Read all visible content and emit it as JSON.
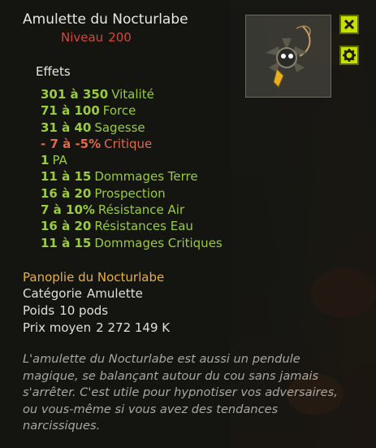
{
  "item": {
    "name": "Amulette du Nocturlabe",
    "level_label": "Niveau",
    "level_value": "200"
  },
  "effects_title": "Effets",
  "effects": [
    {
      "range": "301 à 350",
      "stat": "Vitalité",
      "negative": false
    },
    {
      "range": "71 à 100",
      "stat": "Force",
      "negative": false
    },
    {
      "range": "31 à 40",
      "stat": "Sagesse",
      "negative": false
    },
    {
      "range": "- 7 à -5%",
      "stat": "Critique",
      "negative": true
    },
    {
      "range": "1",
      "stat": "PA",
      "negative": false
    },
    {
      "range": "11 à 15",
      "stat": "Dommages Terre",
      "negative": false
    },
    {
      "range": "16 à 20",
      "stat": "Prospection",
      "negative": false
    },
    {
      "range": "7 à 10%",
      "stat": "Résistance Air",
      "negative": false
    },
    {
      "range": "16 à 20",
      "stat": "Résistances Eau",
      "negative": false
    },
    {
      "range": "11 à 15",
      "stat": "Dommages Critiques",
      "negative": false
    }
  ],
  "set_name": "Panoplie du Nocturlabe",
  "category": {
    "label": "Catégorie",
    "value": "Amulette"
  },
  "weight": {
    "label": "Poids",
    "value": "10 pods"
  },
  "price": {
    "label": "Prix moyen",
    "value": "2 272 149 K"
  },
  "description": "L'amulette du Nocturlabe est aussi un pendule magique, se balançant autour du cou sans jamais s'arrêter. C'est utile pour hypnotiser vos adversaires, ou vous-même si vous avez des tendances narcissiques.",
  "icons": {
    "close": "close-icon",
    "settings": "gear-icon",
    "item": "amulet-icon"
  },
  "colors": {
    "effect": "#9acc3c",
    "negative": "#e06a4a",
    "set": "#e8b040",
    "level": "#d04a3a",
    "button": "#c8e000"
  }
}
